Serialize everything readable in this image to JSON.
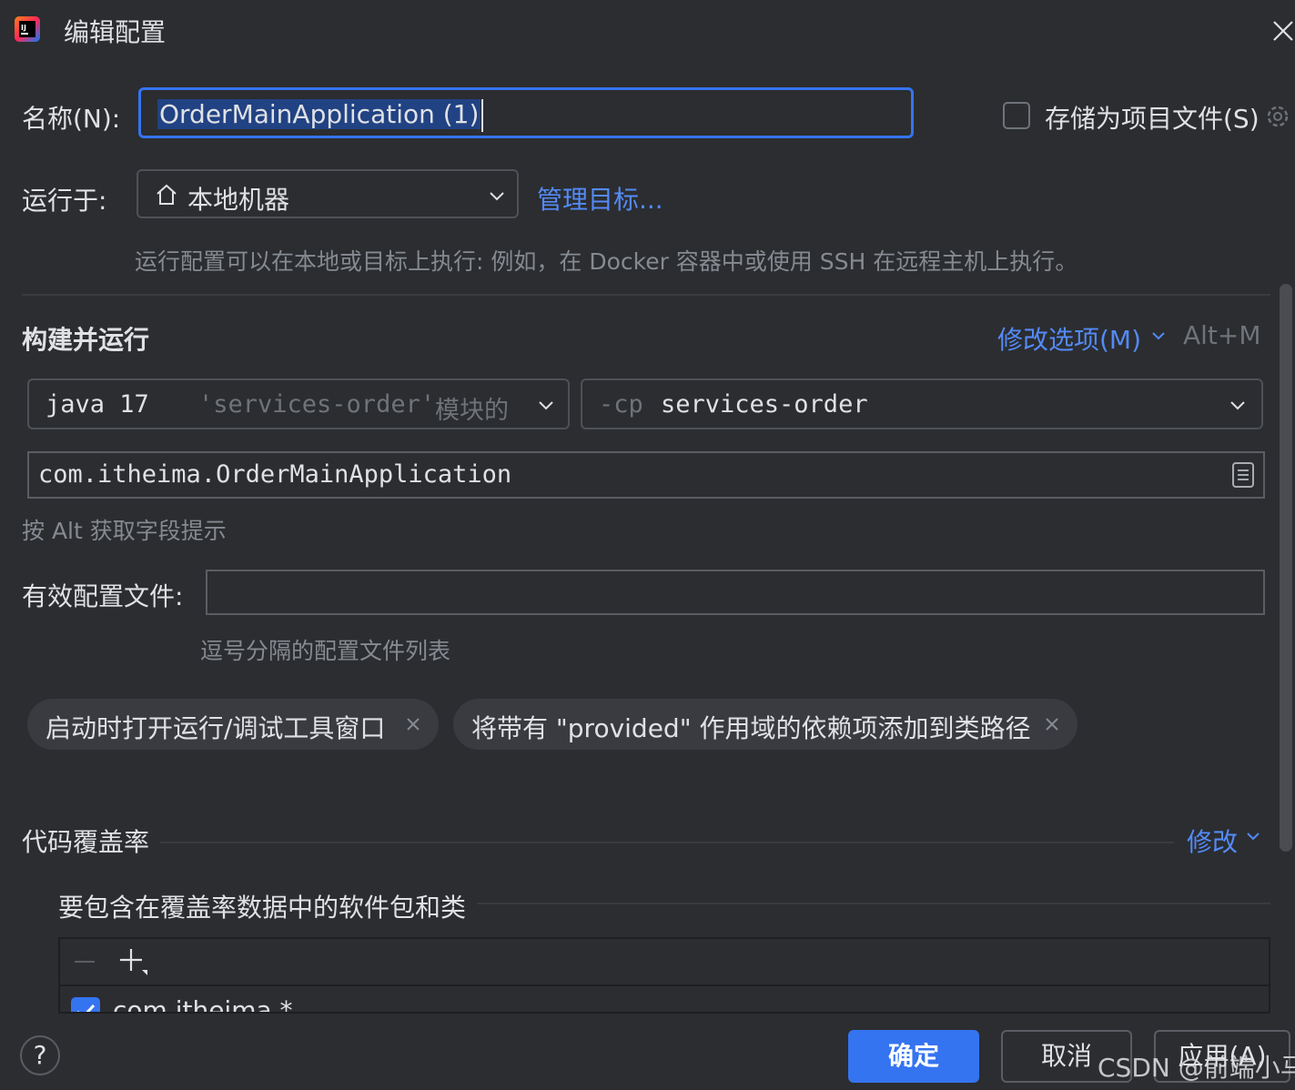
{
  "window": {
    "title": "编辑配置"
  },
  "name": {
    "label": "名称(N):",
    "value": "OrderMainApplication (1)"
  },
  "store": {
    "label": "存储为项目文件(S)",
    "checked": false
  },
  "run_on": {
    "label": "运行于:",
    "value": "本地机器",
    "manage_link": "管理目标...",
    "hint": "运行配置可以在本地或目标上执行: 例如，在 Docker 容器中或使用 SSH 在远程主机上执行。"
  },
  "build": {
    "title": "构建并运行",
    "modify_options": "修改选项(M)",
    "shortcut": "Alt+M",
    "jdk": {
      "java": "java 17",
      "module": "'services-order'",
      "suffix": "模块的"
    },
    "classpath": {
      "flag": "-cp",
      "module": "services-order"
    },
    "main_class": "com.itheima.OrderMainApplication",
    "alt_hint": "按 Alt 获取字段提示",
    "profiles_label": "有效配置文件:",
    "profiles_value": "",
    "profiles_hint": "逗号分隔的配置文件列表",
    "chips": [
      {
        "label": "启动时打开运行/调试工具窗口"
      },
      {
        "label": "将带有 \"provided\" 作用域的依赖项添加到类路径"
      }
    ]
  },
  "coverage": {
    "title": "代码覆盖率",
    "modify": "修改",
    "subtitle": "要包含在覆盖率数据中的软件包和类",
    "packages": [
      {
        "pattern": "com.itheima.*",
        "checked": true
      }
    ]
  },
  "footer": {
    "help": "?",
    "ok": "确定",
    "cancel": "取消",
    "apply": "应用(A)",
    "watermark": "CSDN @前端小马"
  },
  "colors": {
    "background": "#2b2d30",
    "accent": "#3574f0",
    "link": "#548af7",
    "hint": "#868a91"
  }
}
